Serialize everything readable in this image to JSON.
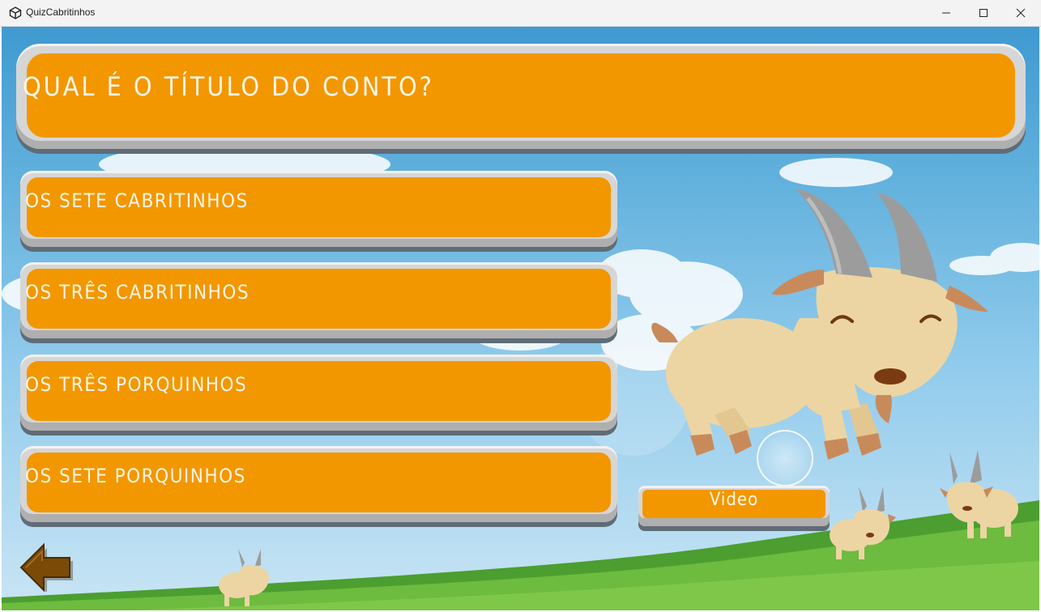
{
  "window": {
    "title": "QuizCabritinhos",
    "app_icon": "unity-icon",
    "controls": [
      "minimize-icon",
      "maximize-icon",
      "close-icon"
    ]
  },
  "quiz": {
    "question": "QUAL É O TÍTULO DO CONTO?",
    "answers": [
      "OS SETE CABRITINHOS",
      "OS TRÊS CABRITINHOS",
      "OS TRÊS PORQUINHOS",
      "OS SETE PORQUINHOS"
    ],
    "video_label": "Video",
    "back_icon": "back-arrow-icon"
  },
  "colors": {
    "button_orange": "#f39700",
    "bevel_grey": "#d6d6d6",
    "sky_blue": "#67b4df",
    "grass_green": "#5fae3a",
    "back_arrow_brown": "#7a4a06"
  }
}
